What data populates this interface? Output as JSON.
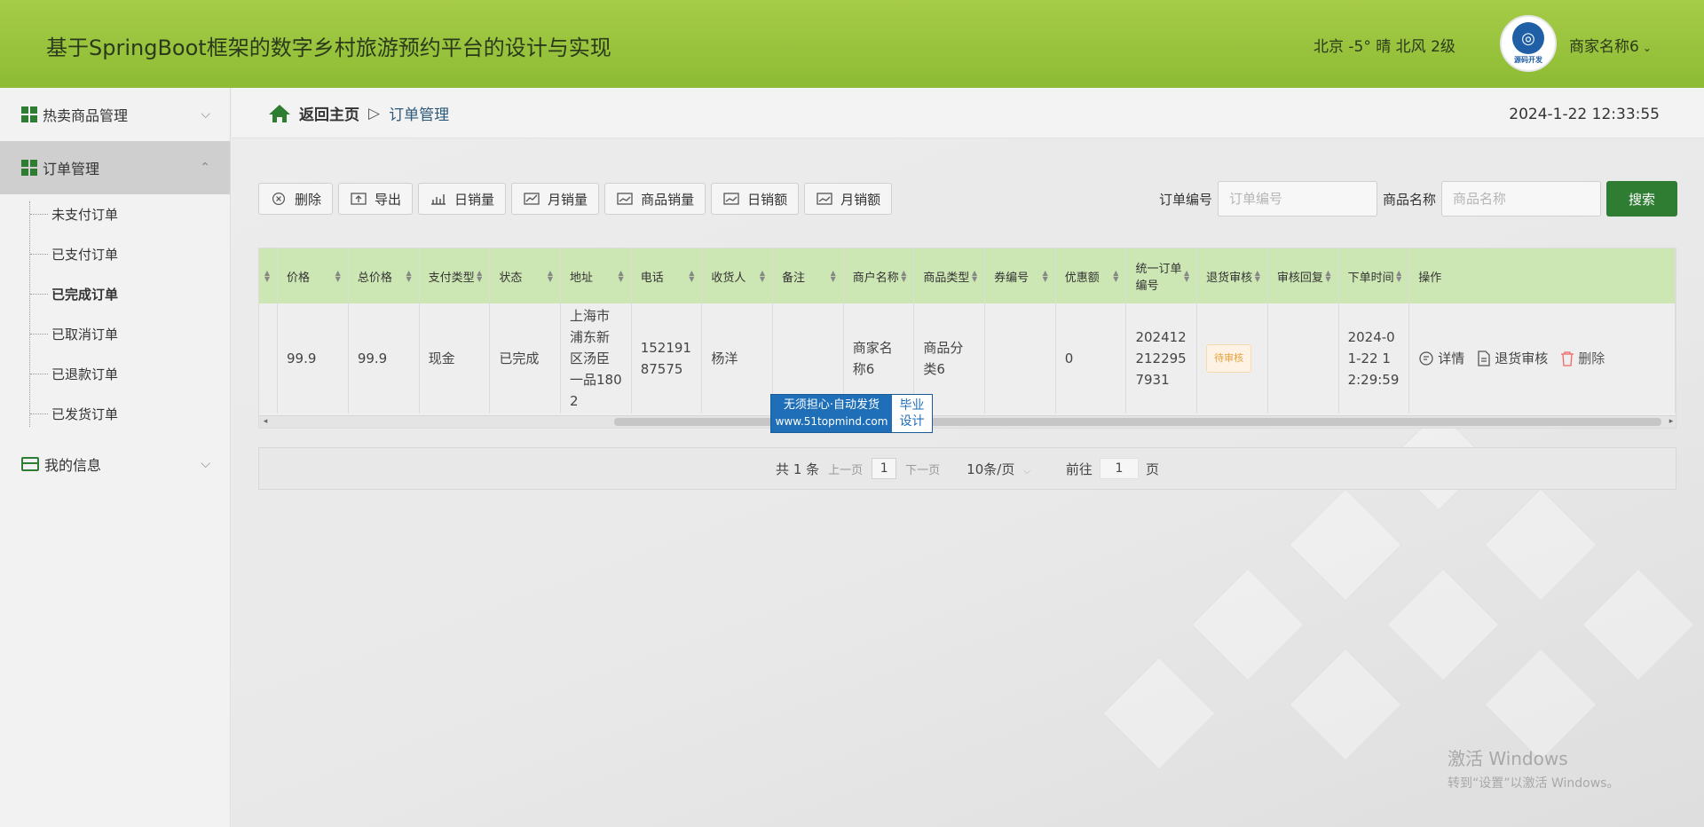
{
  "header": {
    "title": "基于SpringBoot框架的数字乡村旅游预约平台的设计与实现",
    "weather": "北京  -5°  晴  北风  2级",
    "logo_text": "源码开发",
    "user_name": "商家名称6"
  },
  "sidebar": {
    "items": [
      {
        "label": "热卖商品管理",
        "icon": "grid-icon",
        "expanded": false
      },
      {
        "label": "订单管理",
        "icon": "grid-icon",
        "expanded": true,
        "children": [
          "未支付订单",
          "已支付订单",
          "已完成订单",
          "已取消订单",
          "已退款订单",
          "已发货订单"
        ]
      },
      {
        "label": "我的信息",
        "icon": "card-icon",
        "expanded": false
      }
    ],
    "current_child": "已完成订单"
  },
  "breadcrumb": {
    "home": "返回主页",
    "separator": "▷",
    "current": "订单管理"
  },
  "datetime": "2024-1-22 12:33:55",
  "toolbar": {
    "buttons": [
      "删除",
      "导出",
      "日销量",
      "月销量",
      "商品销量",
      "日销额",
      "月销额"
    ]
  },
  "search": {
    "order_label": "订单编号",
    "order_placeholder": "订单编号",
    "goods_label": "商品名称",
    "goods_placeholder": "商品名称",
    "button": "搜索"
  },
  "table": {
    "columns": [
      "价格",
      "总价格",
      "支付类型",
      "状态",
      "地址",
      "电话",
      "收货人",
      "备注",
      "商户名称",
      "商品类型",
      "券编号",
      "优惠额",
      "统一订单编号",
      "退货审核",
      "审核回复",
      "下单时间",
      "操作"
    ],
    "rows": [
      {
        "price": "99.9",
        "total": "99.9",
        "pay_type": "现金",
        "status": "已完成",
        "address": "上海市浦东新区汤臣一品1802",
        "phone": "15219187575",
        "receiver": "杨洋",
        "remark": "",
        "merchant": "商家名称6",
        "goods_type": "商品分类6",
        "coupon": "",
        "discount": "0",
        "order_no": "2024122122957931",
        "return_audit": "待审核",
        "audit_reply": "",
        "order_time": "2024-01-22 12:29:59",
        "ops": [
          "详情",
          "退货审核",
          "删除"
        ]
      }
    ]
  },
  "promo": {
    "line1": "无须担心·自动发货",
    "line2": "www.51topmind.com",
    "tag1": "毕业",
    "tag2": "设计"
  },
  "pager": {
    "total": "共 1 条",
    "prev": "上一页",
    "page": "1",
    "next": "下一页",
    "size": "10条/页",
    "goto_label": "前往",
    "goto_value": "1",
    "goto_suffix": "页"
  },
  "windows": {
    "line1": "激活 Windows",
    "line2": "转到“设置”以激活 Windows。"
  },
  "colors": {
    "header": "#8dbb34",
    "accent": "#2e7d32",
    "table_header": "#cde7b4",
    "badge": "#e6a23c"
  }
}
